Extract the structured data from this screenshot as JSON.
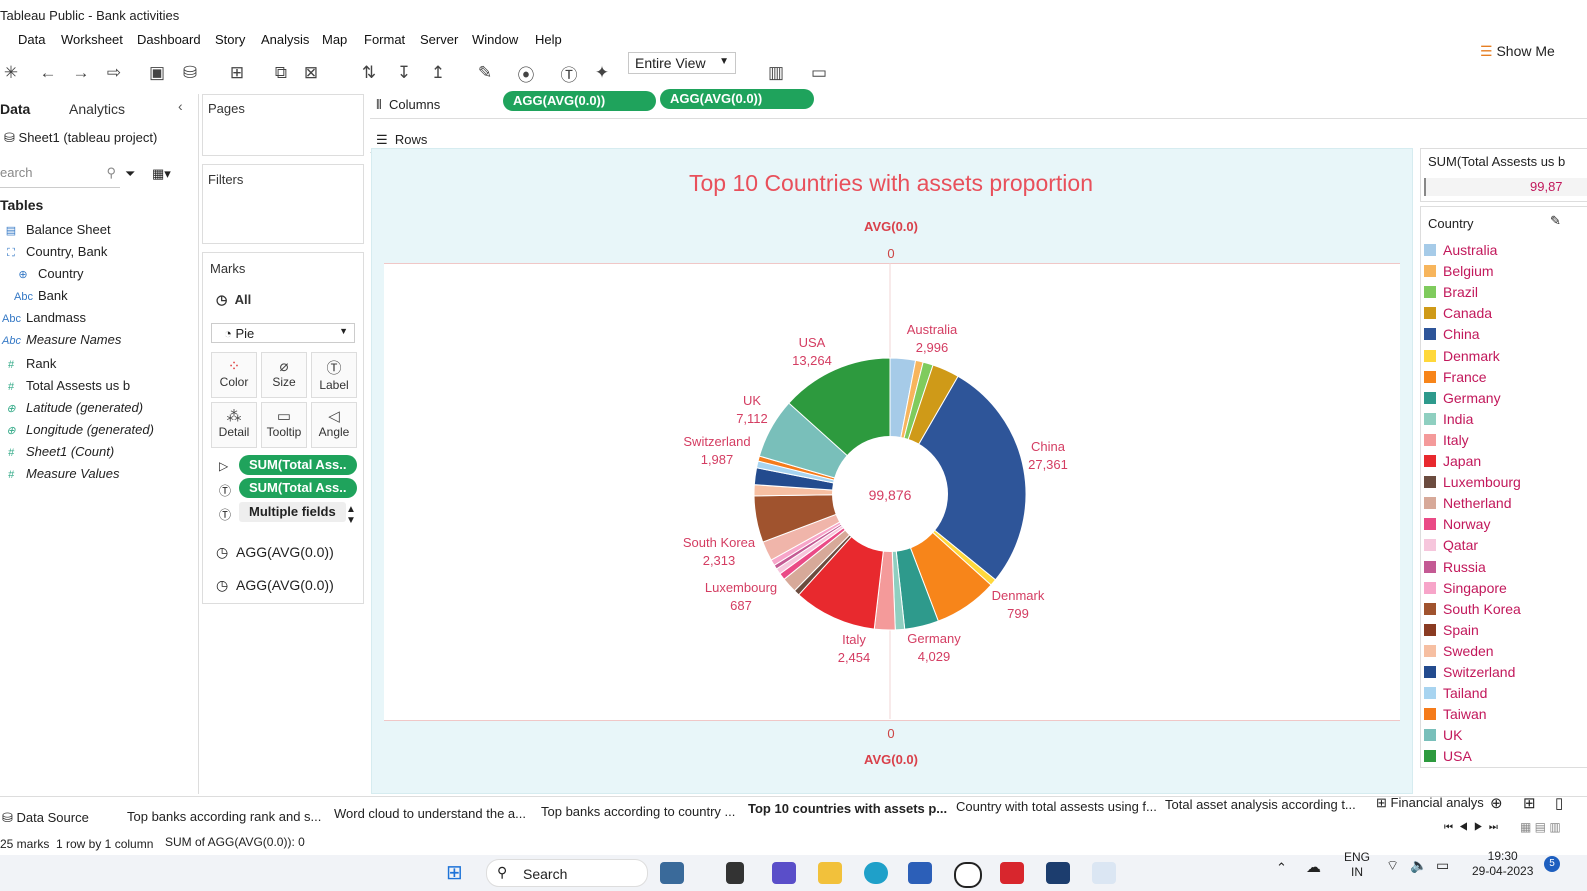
{
  "window": {
    "title": "Tableau Public - Bank activities"
  },
  "menu": [
    "Data",
    "Worksheet",
    "Dashboard",
    "Story",
    "Analysis",
    "Map",
    "Format",
    "Server",
    "Window",
    "Help"
  ],
  "toolbar": {
    "view_mode": "Entire View",
    "show_me": "Show Me"
  },
  "left_panel": {
    "tab_data": "Data",
    "tab_analytics": "Analytics",
    "source": "Sheet1 (tableau project)",
    "search_placeholder": "earch",
    "tables_header": "Tables",
    "fields": [
      {
        "label": "Balance Sheet",
        "type": "table"
      },
      {
        "label": "Country, Bank",
        "type": "hierarchy"
      },
      {
        "label": "Country",
        "type": "geo"
      },
      {
        "label": "Bank",
        "type": "abc"
      },
      {
        "label": "Landmass",
        "type": "abc"
      },
      {
        "label": "Measure Names",
        "type": "abc"
      },
      {
        "label": "Rank",
        "type": "num"
      },
      {
        "label": "Total Assests us b",
        "type": "num"
      },
      {
        "label": "Latitude (generated)",
        "type": "geo"
      },
      {
        "label": "Longitude (generated)",
        "type": "geo"
      },
      {
        "label": "Sheet1 (Count)",
        "type": "num"
      },
      {
        "label": "Measure Values",
        "type": "num"
      }
    ]
  },
  "cards": {
    "pages": "Pages",
    "filters": "Filters",
    "marks": "Marks",
    "marks_all": "All",
    "mark_type": "Pie",
    "mark_buttons": [
      "Color",
      "Size",
      "Label",
      "Detail",
      "Tooltip",
      "Angle"
    ],
    "mark_pills": [
      "SUM(Total Ass..",
      "SUM(Total Ass..",
      "Multiple fields"
    ],
    "agg_rows": [
      "AGG(AVG(0.0))",
      "AGG(AVG(0.0))"
    ]
  },
  "shelves": {
    "columns_label": "Columns",
    "rows_label": "Rows",
    "column_pills": [
      "AGG(AVG(0.0))",
      "AGG(AVG(0.0))"
    ]
  },
  "viz": {
    "title": "Top 10 Countries with assets proportion",
    "top_axis_label": "AVG(0.0)",
    "top_axis_tick": "0",
    "bottom_axis_tick": "0",
    "bottom_axis_label": "AVG(0.0)",
    "center_total": "99,876"
  },
  "chart_data": {
    "type": "pie",
    "title": "Top 10 Countries with assets proportion",
    "total": 99876,
    "slices": [
      {
        "name": "Australia",
        "value": 2996,
        "color": "#a6cbe8",
        "labeled": true
      },
      {
        "name": "Belgium",
        "value": 900,
        "color": "#f7b55c",
        "labeled": false
      },
      {
        "name": "Brazil",
        "value": 1200,
        "color": "#7fcb5d",
        "labeled": false
      },
      {
        "name": "Canada",
        "value": 3200,
        "color": "#cf9a18",
        "labeled": false
      },
      {
        "name": "China",
        "value": 27361,
        "color": "#2e5599",
        "labeled": true
      },
      {
        "name": "Denmark",
        "value": 799,
        "color": "#ffd83b",
        "labeled": true
      },
      {
        "name": "France",
        "value": 7500,
        "color": "#f7851a",
        "labeled": false
      },
      {
        "name": "Germany",
        "value": 4029,
        "color": "#2e9a8c",
        "labeled": true
      },
      {
        "name": "India",
        "value": 1100,
        "color": "#8fcfc0",
        "labeled": false
      },
      {
        "name": "Italy",
        "value": 2454,
        "color": "#f49a9a",
        "labeled": true
      },
      {
        "name": "Japan",
        "value": 9800,
        "color": "#e8292e",
        "labeled": false
      },
      {
        "name": "Luxembourg",
        "value": 687,
        "color": "#6b4c3f",
        "labeled": true
      },
      {
        "name": "Netherland",
        "value": 1800,
        "color": "#d7a999",
        "labeled": false
      },
      {
        "name": "Norway",
        "value": 800,
        "color": "#ea4a86",
        "labeled": false
      },
      {
        "name": "Qatar",
        "value": 700,
        "color": "#f6c6dc",
        "labeled": false
      },
      {
        "name": "Russia",
        "value": 500,
        "color": "#c45a94",
        "labeled": false
      },
      {
        "name": "Singapore",
        "value": 700,
        "color": "#f7a5c9",
        "labeled": false
      },
      {
        "name": "South Korea",
        "value": 2313,
        "color": "#f0b5aa",
        "labeled": true
      },
      {
        "name": "Spain",
        "value": 5500,
        "color": "#a0532e",
        "labeled": false
      },
      {
        "name": "Sweden",
        "value": 1300,
        "color": "#f6bfa2",
        "labeled": false
      },
      {
        "name": "Switzerland",
        "value": 1987,
        "color": "#234b8e",
        "labeled": true
      },
      {
        "name": "Tailand",
        "value": 800,
        "color": "#a8d4f0",
        "labeled": false
      },
      {
        "name": "Taiwan",
        "value": 600,
        "color": "#f57b1a",
        "labeled": false
      },
      {
        "name": "UK",
        "value": 7112,
        "color": "#79bfba",
        "labeled": true
      },
      {
        "name": "USA",
        "value": 13264,
        "color": "#2d9a3e",
        "labeled": true
      }
    ]
  },
  "pie_labels": [
    {
      "name": "Australia",
      "value": "2,996"
    },
    {
      "name": "China",
      "value": "27,361"
    },
    {
      "name": "Denmark",
      "value": "799"
    },
    {
      "name": "Germany",
      "value": "4,029"
    },
    {
      "name": "Italy",
      "value": "2,454"
    },
    {
      "name": "Luxembourg",
      "value": "687"
    },
    {
      "name": "South Korea",
      "value": "2,313"
    },
    {
      "name": "Switzerland",
      "value": "1,987"
    },
    {
      "name": "UK",
      "value": "7,112"
    },
    {
      "name": "USA",
      "value": "13,264"
    }
  ],
  "right_panel": {
    "size_title": "SUM(Total Assests us b",
    "size_value": "99,87",
    "legend_title": "Country",
    "legend": [
      {
        "name": "Australia",
        "color": "#a6cbe8"
      },
      {
        "name": "Belgium",
        "color": "#f7b55c"
      },
      {
        "name": "Brazil",
        "color": "#7fcb5d"
      },
      {
        "name": "Canada",
        "color": "#cf9a18"
      },
      {
        "name": "China",
        "color": "#2e5599"
      },
      {
        "name": "Denmark",
        "color": "#ffd83b"
      },
      {
        "name": "France",
        "color": "#f7851a"
      },
      {
        "name": "Germany",
        "color": "#2e9a8c"
      },
      {
        "name": "India",
        "color": "#8fcfc0"
      },
      {
        "name": "Italy",
        "color": "#f49a9a"
      },
      {
        "name": "Japan",
        "color": "#e8292e"
      },
      {
        "name": "Luxembourg",
        "color": "#6b4c3f"
      },
      {
        "name": "Netherland",
        "color": "#d7a999"
      },
      {
        "name": "Norway",
        "color": "#ea4a86"
      },
      {
        "name": "Qatar",
        "color": "#f6c6dc"
      },
      {
        "name": "Russia",
        "color": "#c45a94"
      },
      {
        "name": "Singapore",
        "color": "#f7a5c9"
      },
      {
        "name": "South Korea",
        "color": "#a0532e"
      },
      {
        "name": "Spain",
        "color": "#8a3b22"
      },
      {
        "name": "Sweden",
        "color": "#f6bfa2"
      },
      {
        "name": "Switzerland",
        "color": "#234b8e"
      },
      {
        "name": "Tailand",
        "color": "#a8d4f0"
      },
      {
        "name": "Taiwan",
        "color": "#f57b1a"
      },
      {
        "name": "UK",
        "color": "#79bfba"
      },
      {
        "name": "USA",
        "color": "#2d9a3e"
      }
    ]
  },
  "sheet_tabs": [
    "Data Source",
    "Top banks according rank and s...",
    "Word cloud to understand the a...",
    "Top banks according to country ...",
    "Top 10 countries with assets p...",
    "Country with total assests using f...",
    "Total asset analysis according t...",
    "Financial analys"
  ],
  "status": {
    "marks": "25 marks",
    "layout": "1 row by 1 column",
    "sum": "SUM of AGG(AVG(0.0)): 0"
  },
  "taskbar": {
    "search": "Search",
    "lang": "ENG",
    "region": "IN",
    "time": "19:30",
    "date": "29-04-2023",
    "badge": "5"
  }
}
